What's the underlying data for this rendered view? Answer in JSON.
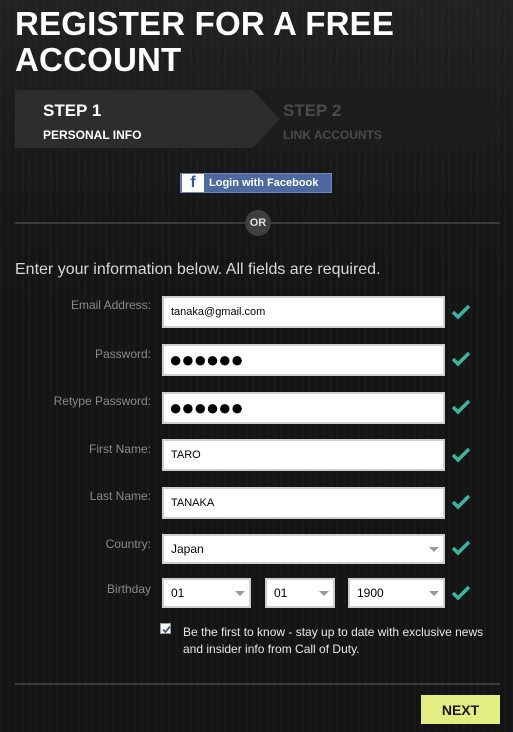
{
  "header": {
    "title": "REGISTER FOR A FREE ACCOUNT"
  },
  "steps": [
    {
      "number": "STEP 1",
      "label": "PERSONAL INFO",
      "active": true
    },
    {
      "number": "STEP 2",
      "label": "LINK ACCOUNTS",
      "active": false
    }
  ],
  "facebook": {
    "logo": "f",
    "label": "Login with Facebook"
  },
  "separator": {
    "or_label": "OR"
  },
  "form": {
    "intro": "Enter your information below. All fields are required.",
    "email": {
      "label": "Email Address:",
      "value": "tanaka@gmail.com"
    },
    "password": {
      "label": "Password:",
      "value": "●●●●●●"
    },
    "retype_password": {
      "label": "Retype Password:",
      "value": "●●●●●●"
    },
    "first_name": {
      "label": "First Name:",
      "value": "TARO"
    },
    "last_name": {
      "label": "Last Name:",
      "value": "TANAKA"
    },
    "country": {
      "label": "Country:",
      "value": "Japan"
    },
    "birthday": {
      "label": "Birthday",
      "month": "01",
      "day": "01",
      "year": "1900"
    },
    "newsletter": {
      "checked": true,
      "label": "Be the first to know - stay up to date with exclusive news and insider info from Call of Duty."
    }
  },
  "actions": {
    "next_label": "NEXT"
  },
  "icons": {
    "valid": "checkmark-icon",
    "facebook": "facebook-icon",
    "dropdown": "chevron-down-icon"
  },
  "colors": {
    "check": "#3bb5a0",
    "next_bg": "#e3ee82",
    "facebook_bg": "#4e69a2"
  }
}
